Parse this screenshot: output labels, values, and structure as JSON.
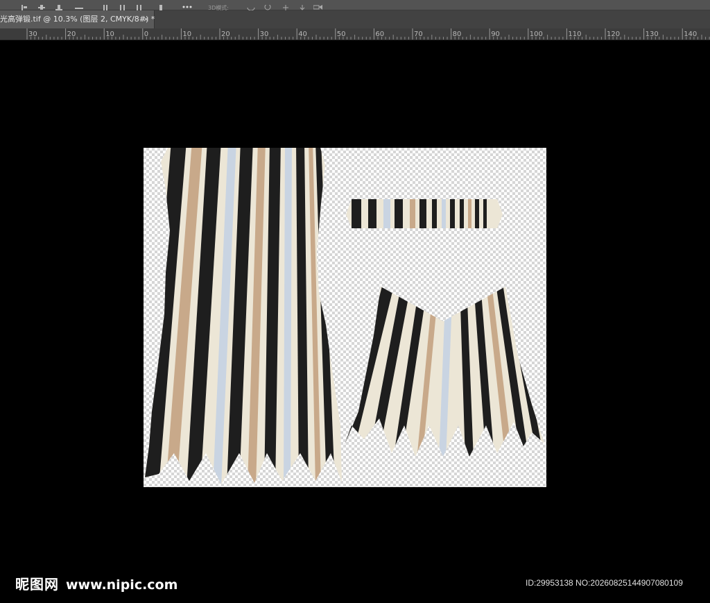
{
  "toolbar": {
    "icons": [
      "align-left-edges-icon",
      "align-vertical-centers-icon",
      "align-bottom-edges-icon",
      "align-horizontal-icon",
      "distribute-left-icon",
      "distribute-horizontal-icon",
      "distribute-right-icon",
      "distribute-widths-icon",
      "more-options-icon",
      "3d-mode-icon",
      "orbit-icon",
      "pan-3d-icon",
      "slide-3d-icon",
      "scale-3d-icon"
    ]
  },
  "tab": {
    "title": "光高弹锻.tif @ 10.3% (图层 2, CMYK/8#) *",
    "close": "×"
  },
  "ruler": {
    "labels": [
      "30",
      "20",
      "10",
      "0",
      "10",
      "20",
      "30",
      "40",
      "50",
      "60",
      "70",
      "80",
      "90",
      "100",
      "110",
      "120",
      "130",
      "140"
    ]
  },
  "watermark": {
    "logo": "昵图网",
    "url": "www.nipic.com",
    "id_text": "ID:29953138 NO:20260825144907080109"
  },
  "colors": {
    "canvas_bg": "#000000",
    "ui_panel": "#535353",
    "tab_bg": "#5a5a5a",
    "ruler_bg": "#3c3c3c",
    "stripe_dark": "#1e1e1e",
    "stripe_cream": "#ece6d6",
    "stripe_blue": "#c9d4e2",
    "stripe_tan": "#c8a98a"
  }
}
